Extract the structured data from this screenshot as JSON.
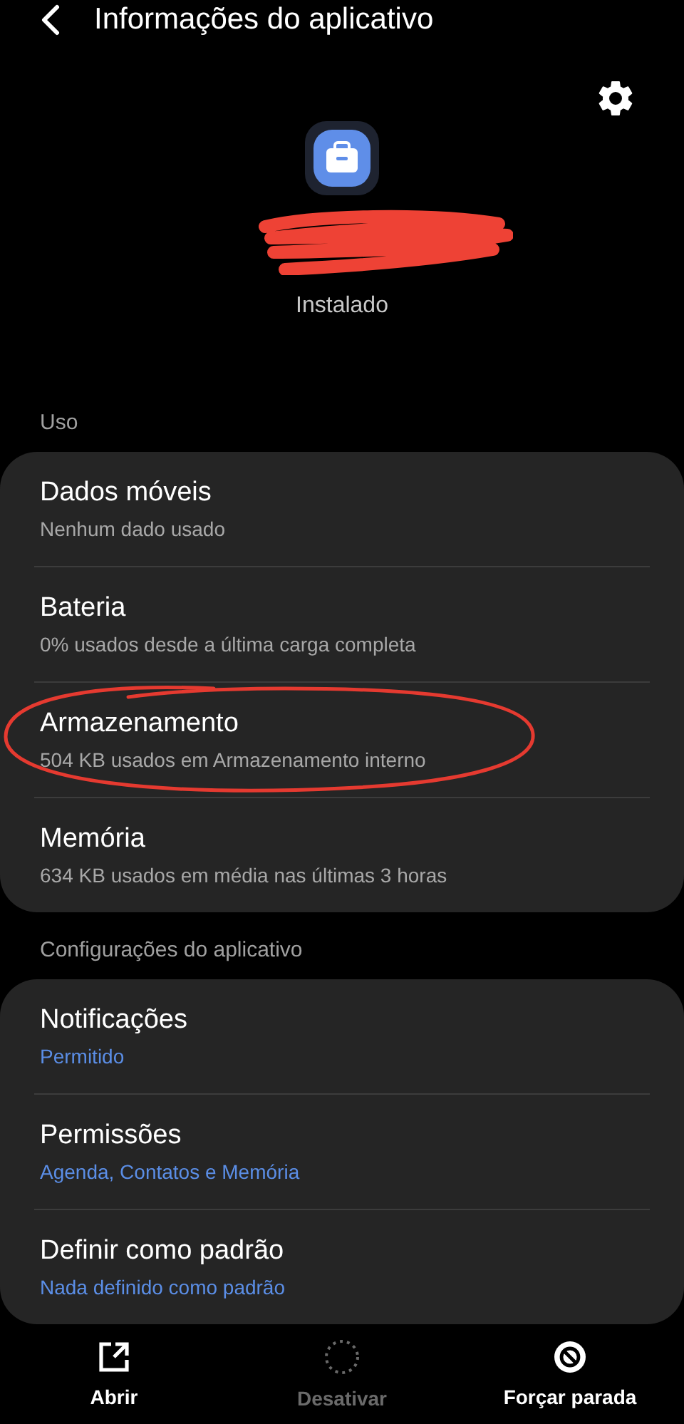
{
  "header": {
    "title": "Informações do aplicativo"
  },
  "app": {
    "status": "Instalado"
  },
  "sections": [
    {
      "title": "Uso",
      "items": [
        {
          "title": "Dados móveis",
          "subtitle": "Nenhum dado usado",
          "kind": "info",
          "circled": false
        },
        {
          "title": "Bateria",
          "subtitle": "0% usados desde a última carga completa",
          "kind": "info",
          "circled": false
        },
        {
          "title": "Armazenamento",
          "subtitle": "504 KB usados em Armazenamento interno",
          "kind": "info",
          "circled": true
        },
        {
          "title": "Memória",
          "subtitle": "634 KB usados em média nas últimas 3 horas",
          "kind": "info",
          "circled": false
        }
      ]
    },
    {
      "title": "Configurações do aplicativo",
      "items": [
        {
          "title": "Notificações",
          "subtitle": "Permitido",
          "kind": "link",
          "circled": false
        },
        {
          "title": "Permissões",
          "subtitle": "Agenda, Contatos e Memória",
          "kind": "link",
          "circled": false
        },
        {
          "title": "Definir como padrão",
          "subtitle": "Nada definido como padrão",
          "kind": "link",
          "circled": false
        }
      ]
    }
  ],
  "bottom_actions": [
    {
      "label": "Abrir",
      "kind": "open",
      "disabled": false
    },
    {
      "label": "Desativar",
      "kind": "disable",
      "disabled": true
    },
    {
      "label": "Forçar parada",
      "kind": "stop",
      "disabled": false
    }
  ]
}
